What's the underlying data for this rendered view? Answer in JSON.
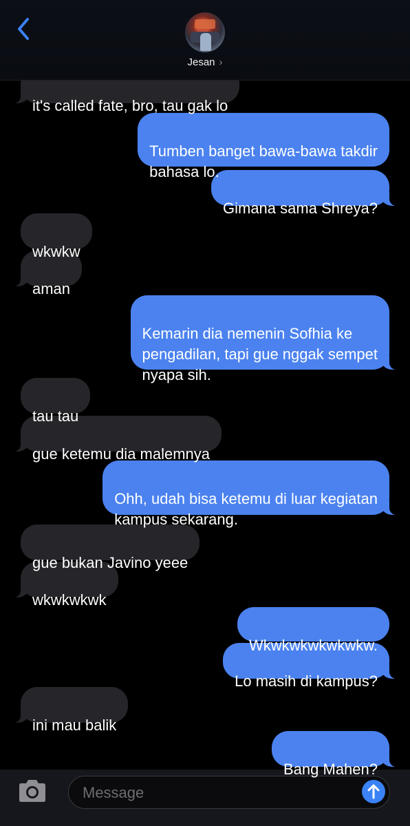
{
  "header": {
    "contact_name": "Jesan",
    "back_icon": "chevron-left-icon",
    "chevron": "›"
  },
  "messages": [
    {
      "direction": "in",
      "text": "it's called fate, bro, tau gak lo"
    },
    {
      "direction": "out",
      "text": "Tumben banget bawa-bawa takdir\nbahasa lo."
    },
    {
      "direction": "out",
      "text": "Gimana sama Shreya?"
    },
    {
      "direction": "in",
      "text": "wkwkw"
    },
    {
      "direction": "in",
      "text": "aman"
    },
    {
      "direction": "out",
      "text": "Kemarin dia nemenin Sofhia ke\npengadilan, tapi gue nggak sempet\nnyapa sih."
    },
    {
      "direction": "in",
      "text": "tau tau"
    },
    {
      "direction": "in",
      "text": "gue ketemu dia malemnya"
    },
    {
      "direction": "out",
      "text": "Ohh, udah bisa ketemu di luar kegiatan\nkampus sekarang."
    },
    {
      "direction": "in",
      "text": "gue bukan Javino yeee"
    },
    {
      "direction": "in",
      "text": "wkwkwkwk"
    },
    {
      "direction": "out",
      "text": "Wkwkwkwkwkwkw."
    },
    {
      "direction": "out",
      "text": "Lo masih di kampus?"
    },
    {
      "direction": "in",
      "text": "ini mau balik"
    },
    {
      "direction": "out",
      "text": "Bang Mahen?"
    }
  ],
  "composer": {
    "placeholder": "Message",
    "camera_icon": "camera-icon",
    "send_icon": "arrow-up-icon"
  },
  "colors": {
    "incoming_bubble": "#26262a",
    "outgoing_bubble": "#4b82ef",
    "accent": "#3b82f6",
    "background": "#000000"
  }
}
